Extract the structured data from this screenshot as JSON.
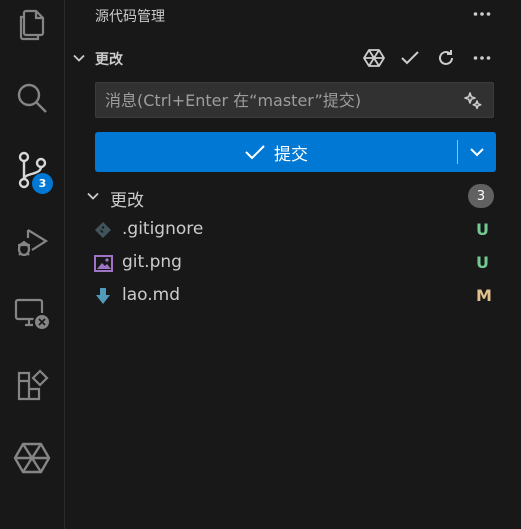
{
  "activity_bar": {
    "items": [
      {
        "name": "explorer",
        "icon": "files-icon"
      },
      {
        "name": "search",
        "icon": "search-icon"
      },
      {
        "name": "source-control",
        "icon": "source-control-icon",
        "badge": "3"
      },
      {
        "name": "run-debug",
        "icon": "run-debug-icon"
      },
      {
        "name": "remote-explorer",
        "icon": "remote-explorer-icon"
      },
      {
        "name": "extensions",
        "icon": "extensions-icon"
      },
      {
        "name": "copilot",
        "icon": "copilot-icon"
      }
    ]
  },
  "panel": {
    "title": "源代码管理"
  },
  "section": {
    "label": "更改",
    "actions": [
      "copilot-icon",
      "check-icon",
      "refresh-icon",
      "more-icon"
    ]
  },
  "commit": {
    "placeholder": "消息(Ctrl+Enter 在“master”提交)",
    "button_label": "提交"
  },
  "changes_group": {
    "label": "更改",
    "count": "3",
    "files": [
      {
        "name": ".gitignore",
        "status": "U",
        "status_color": "#73c991",
        "icon": "gitignore-file-icon"
      },
      {
        "name": "git.png",
        "status": "U",
        "status_color": "#73c991",
        "icon": "image-file-icon"
      },
      {
        "name": "lao.md",
        "status": "M",
        "status_color": "#e2c08d",
        "icon": "markdown-file-icon"
      }
    ]
  },
  "colors": {
    "accent": "#0078d4",
    "background": "#181818",
    "untracked": "#73c991",
    "modified": "#e2c08d"
  }
}
